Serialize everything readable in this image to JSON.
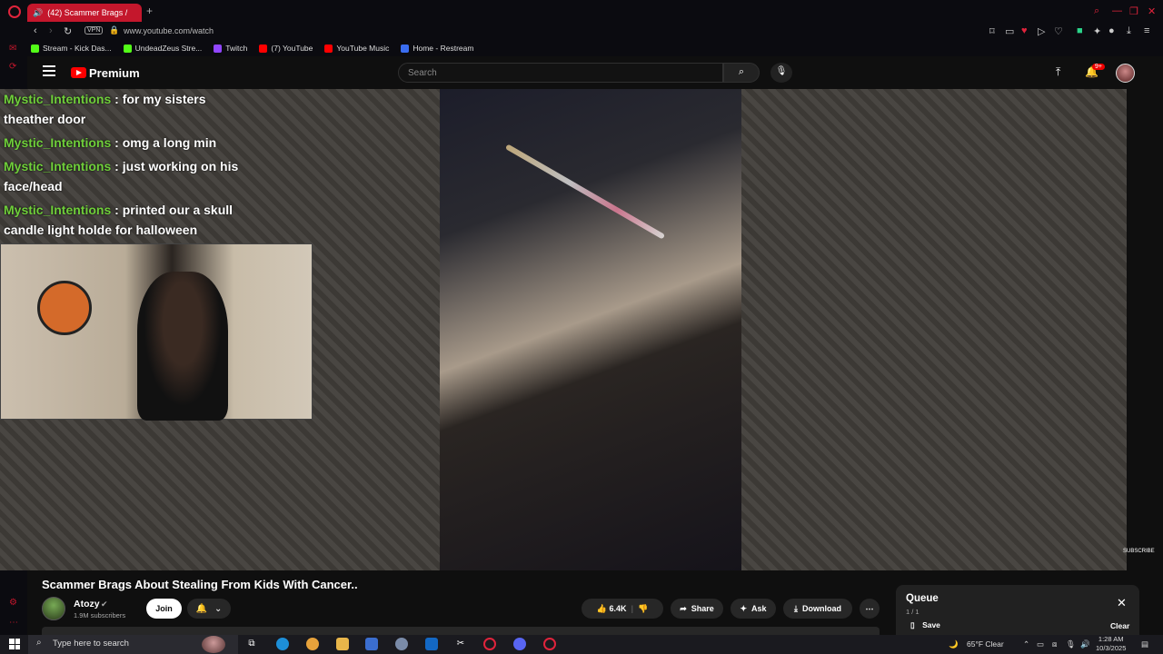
{
  "browser": {
    "tab_title": "(42) Scammer Brags /",
    "url": "www.youtube.com/watch",
    "vpn_label": "VPN",
    "bookmarks": [
      {
        "label": "Stream - Kick Das...",
        "color": "#53fc18"
      },
      {
        "label": "UndeadZeus Stre...",
        "color": "#53fc18"
      },
      {
        "label": "Twitch",
        "color": "#9146ff"
      },
      {
        "label": "(7) YouTube",
        "color": "#ff0000"
      },
      {
        "label": "YouTube Music",
        "color": "#ff0000"
      },
      {
        "label": "Home - Restream",
        "color": "#3a6df0"
      }
    ]
  },
  "youtube": {
    "brand": "Premium",
    "search_placeholder": "Search",
    "notification_count": "9+"
  },
  "chat": {
    "messages": [
      {
        "user": "Mystic_Intentions",
        "text": " : for my sisters theather door"
      },
      {
        "user": "Mystic_Intentions",
        "text": " : omg a long min"
      },
      {
        "user": "Mystic_Intentions",
        "text": " : just working on his face/head"
      },
      {
        "user": "Mystic_Intentions",
        "text": " : printed our a skull candle light holde for halloween"
      }
    ]
  },
  "video": {
    "title": "Scammer Brags About Stealing From Kids With Cancer..",
    "channel": "Atozy",
    "subscribers": "1.9M subscribers",
    "join_label": "Join",
    "like_count": "6.4K",
    "share_label": "Share",
    "ask_label": "Ask",
    "download_label": "Download",
    "watermark": "SUBSCRIBE"
  },
  "queue": {
    "title": "Queue",
    "count": "1 / 1",
    "save_label": "Save",
    "clear_label": "Clear"
  },
  "taskbar": {
    "search_placeholder": "Type here to search",
    "weather": "65°F  Clear",
    "time": "1:28 AM",
    "date": "10/3/2025"
  }
}
